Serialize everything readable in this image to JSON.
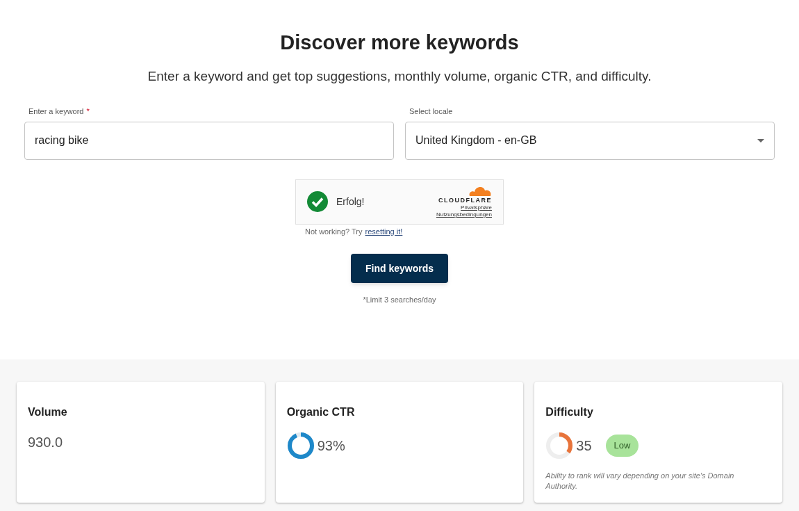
{
  "heading": "Discover more keywords",
  "subheading": "Enter a keyword and get top suggestions, monthly volume, organic CTR, and difficulty.",
  "keyword_field": {
    "label": "Enter a keyword",
    "required_mark": "*",
    "value": "racing bike"
  },
  "locale_select": {
    "label": "Select locale",
    "value": "United Kingdom - en-GB"
  },
  "captcha": {
    "status": "Erfolg!",
    "checked": true,
    "brand": "CLOUDFLARE",
    "links": [
      "Privatsphäre",
      "Nutzungsbedingungen"
    ]
  },
  "reset_hint": {
    "text": "Not working? Try",
    "link": "resetting it!"
  },
  "submit_button": "Find keywords",
  "limit_note": "*Limit 3 searches/day",
  "cards": [
    {
      "kind": "value",
      "title": "Volume",
      "value": "930.0"
    },
    {
      "kind": "ctr",
      "title": "Organic CTR",
      "value": "93%"
    },
    {
      "kind": "difficulty",
      "title": "Difficulty",
      "value": "35",
      "badge": "Low",
      "note": "Ability to rank will vary depending on your site's Domain Authority."
    }
  ]
}
